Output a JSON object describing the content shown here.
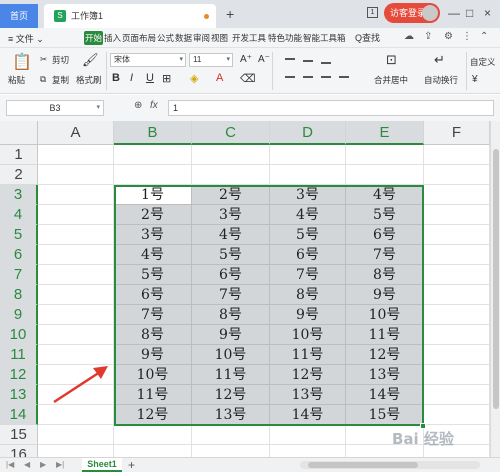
{
  "titlebar": {
    "home_tab": "首页",
    "doc_tab": "工作簿1",
    "doc_icon": "S",
    "new_tab": "+",
    "guest_button": "访客登录",
    "box_icon": "1",
    "minimize": "—",
    "restore": "□",
    "close": "×"
  },
  "menubar": {
    "file": "≡ 文件 ⌄",
    "items": [
      "开始",
      "插入",
      "页面布局",
      "公式",
      "数据",
      "审阅",
      "视图",
      "开发工具",
      "特色功能",
      "智能工具箱"
    ],
    "find": "Q查找"
  },
  "ribbon": {
    "paste": "粘贴",
    "cut": "剪切",
    "copy": "复制",
    "format_painter": "格式刷",
    "font_name": "宋体",
    "font_size": "11",
    "bold": "B",
    "italic": "I",
    "underline": "U",
    "font_color": "A",
    "merge_center": "合并居中",
    "wrap_text": "自动换行",
    "custom": "自定义",
    "currency": "¥"
  },
  "formula_bar": {
    "name_box": "B3",
    "zoom_icon": "⊕",
    "fx": "fx",
    "value": "1"
  },
  "grid": {
    "columns": [
      "A",
      "B",
      "C",
      "D",
      "E",
      "F"
    ],
    "rows": [
      "1",
      "2",
      "3",
      "4",
      "5",
      "6",
      "7",
      "8",
      "9",
      "10",
      "11",
      "12",
      "13",
      "14",
      "15",
      "16"
    ],
    "data": [
      [
        "1号",
        "2号",
        "3号",
        "4号"
      ],
      [
        "2号",
        "3号",
        "4号",
        "5号"
      ],
      [
        "3号",
        "4号",
        "5号",
        "6号"
      ],
      [
        "4号",
        "5号",
        "6号",
        "7号"
      ],
      [
        "5号",
        "6号",
        "7号",
        "8号"
      ],
      [
        "6号",
        "7号",
        "8号",
        "9号"
      ],
      [
        "7号",
        "8号",
        "9号",
        "10号"
      ],
      [
        "8号",
        "9号",
        "10号",
        "11号"
      ],
      [
        "9号",
        "10号",
        "11号",
        "12号"
      ],
      [
        "10号",
        "11号",
        "12号",
        "13号"
      ],
      [
        "11号",
        "12号",
        "13号",
        "14号"
      ],
      [
        "12号",
        "13号",
        "14号",
        "15号"
      ]
    ]
  },
  "sheetbar": {
    "sheet_tab": "Sheet1",
    "add_sheet": "+"
  },
  "watermark": "Bai 经验",
  "colors": {
    "accent": "#2a8a3e",
    "home_tab": "#4a86e8",
    "guest": "#e64a3b",
    "arrow": "#e03a2f"
  }
}
